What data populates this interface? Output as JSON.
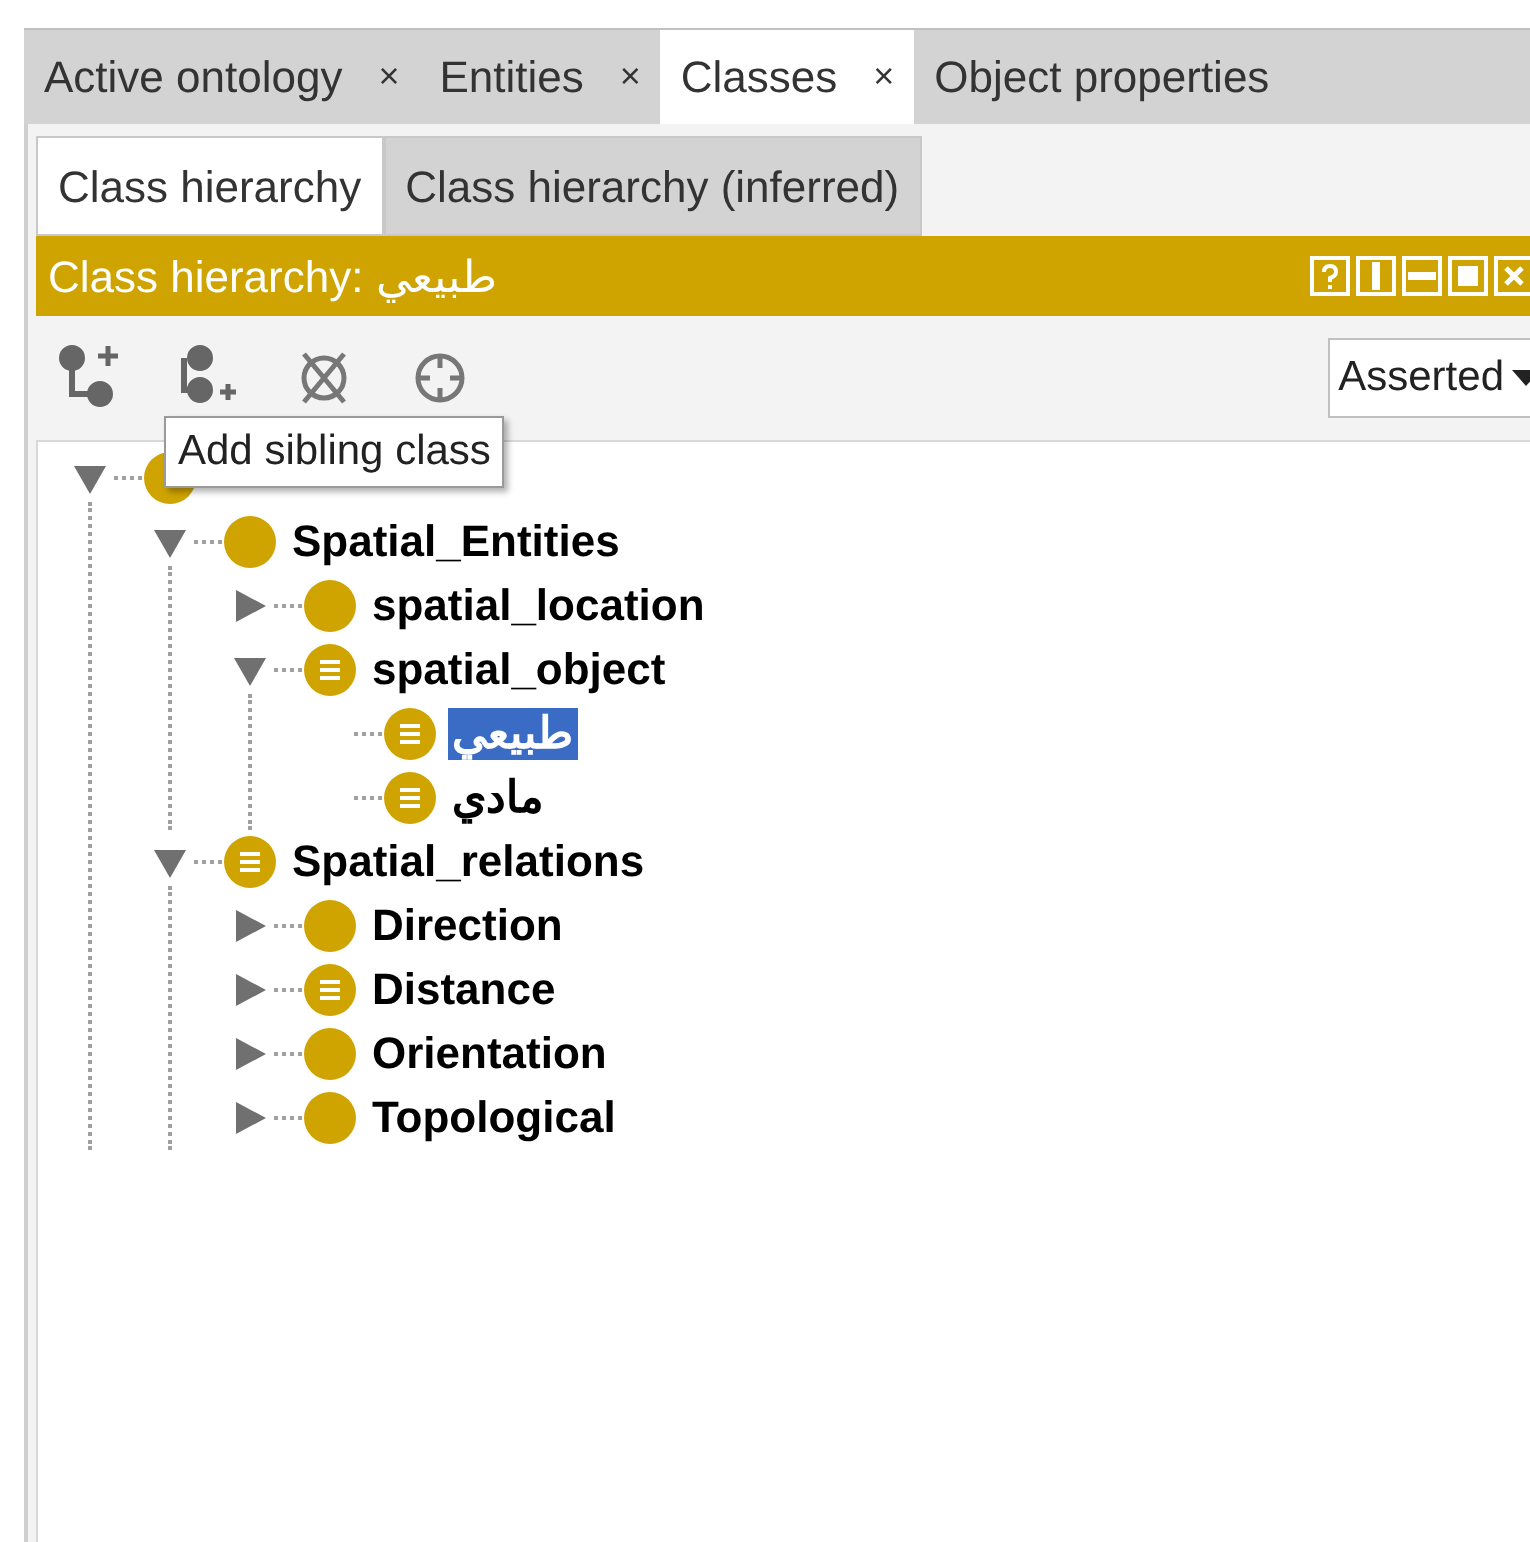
{
  "tabs": [
    {
      "label": "Active ontology",
      "close": "×",
      "selected": false
    },
    {
      "label": "Entities",
      "close": "×",
      "selected": false
    },
    {
      "label": "Classes",
      "close": "×",
      "selected": true
    },
    {
      "label": "Object properties",
      "selected": false
    }
  ],
  "subtabs": [
    {
      "label": "Class hierarchy",
      "selected": true
    },
    {
      "label": "Class hierarchy (inferred)",
      "selected": false
    }
  ],
  "view_header": {
    "title": "Class hierarchy: طبيعي"
  },
  "mode_select": {
    "value": "Asserted"
  },
  "tooltip": "Add sibling class",
  "tree": [
    {
      "expanded": true,
      "children": [
        {
          "label": "Spatial_Entities",
          "kind": "primitive",
          "expanded": true,
          "selected": false,
          "children": [
            {
              "label": "spatial_location",
              "kind": "primitive",
              "expanded": false,
              "selected": false
            },
            {
              "label": "spatial_object",
              "kind": "defined",
              "expanded": true,
              "selected": false,
              "children": [
                {
                  "label": "طبيعي",
                  "kind": "defined",
                  "selected": true
                },
                {
                  "label": "مادي",
                  "kind": "defined",
                  "selected": false
                }
              ]
            }
          ]
        },
        {
          "label": "Spatial_relations",
          "kind": "defined",
          "expanded": true,
          "selected": false,
          "children": [
            {
              "label": "Direction",
              "kind": "primitive",
              "expanded": false,
              "selected": false
            },
            {
              "label": "Distance",
              "kind": "defined",
              "expanded": false,
              "selected": false
            },
            {
              "label": "Orientation",
              "kind": "primitive",
              "expanded": false,
              "selected": false
            },
            {
              "label": "Topological",
              "kind": "primitive",
              "expanded": false,
              "selected": false
            }
          ]
        }
      ]
    }
  ]
}
